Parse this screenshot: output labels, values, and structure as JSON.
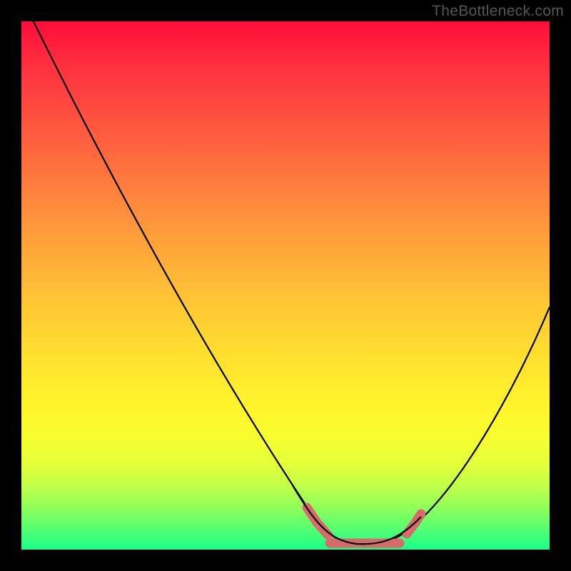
{
  "watermark": "TheBottleneck.com",
  "chart_data": {
    "type": "line",
    "title": "",
    "xlabel": "",
    "ylabel": "",
    "xlim": [
      0,
      100
    ],
    "ylim": [
      0,
      100
    ],
    "series": [
      {
        "name": "curve",
        "x": [
          0,
          10,
          20,
          30,
          40,
          50,
          55,
          60,
          64,
          68,
          72,
          76,
          80,
          86,
          93,
          100
        ],
        "y": [
          100,
          83,
          66,
          49,
          33,
          16,
          8,
          3,
          1,
          1,
          1,
          2,
          6,
          16,
          30,
          46
        ]
      }
    ],
    "highlight": {
      "name": "detected-points",
      "color": "#d86a6a",
      "xrange": [
        55,
        76
      ],
      "yband": 1
    },
    "background": "rainbow-vertical",
    "grid": false,
    "legend": false
  },
  "colors": {
    "curve": "#000000",
    "highlight": "#d86a6a",
    "frame": "#000000"
  }
}
